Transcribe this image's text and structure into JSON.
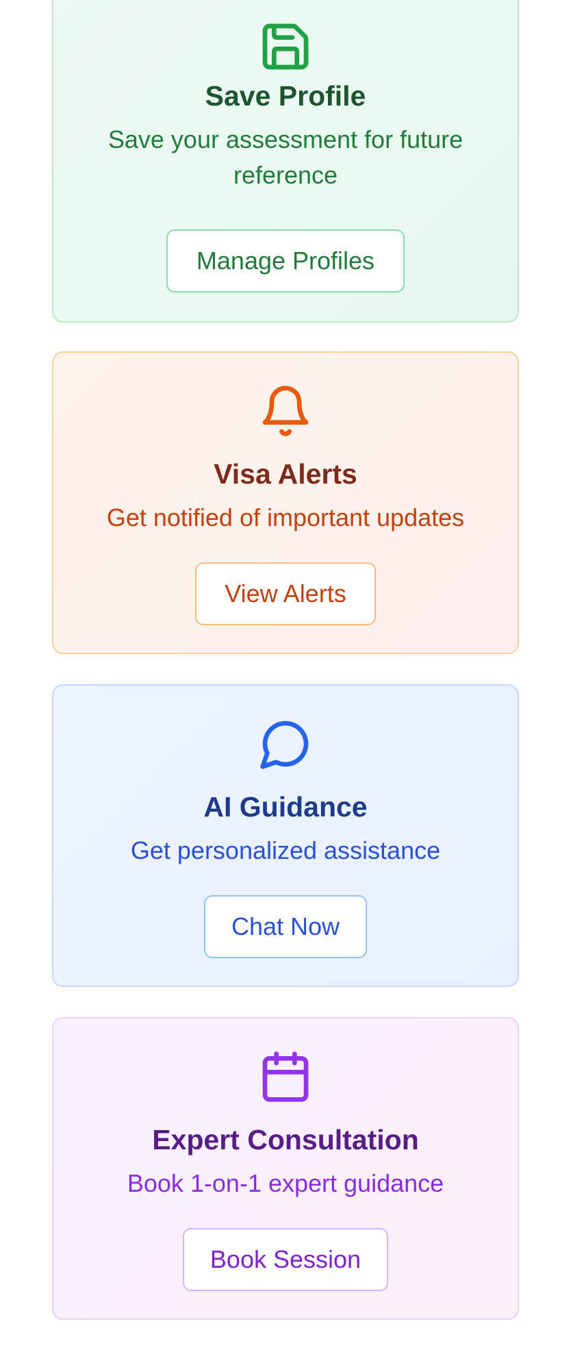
{
  "cards": [
    {
      "icon": "save-icon",
      "title": "Save Profile",
      "description": "Save your assessment for future reference",
      "button_label": "Manage Profiles",
      "accent": "#22a045"
    },
    {
      "icon": "bell-icon",
      "title": "Visa Alerts",
      "description": "Get notified of important updates",
      "button_label": "View Alerts",
      "accent": "#ea580c"
    },
    {
      "icon": "chat-icon",
      "title": "AI Guidance",
      "description": "Get personalized assistance",
      "button_label": "Chat Now",
      "accent": "#2563eb"
    },
    {
      "icon": "calendar-icon",
      "title": "Expert Consultation",
      "description": "Book 1-on-1 expert guidance",
      "button_label": "Book Session",
      "accent": "#9333ea"
    }
  ]
}
